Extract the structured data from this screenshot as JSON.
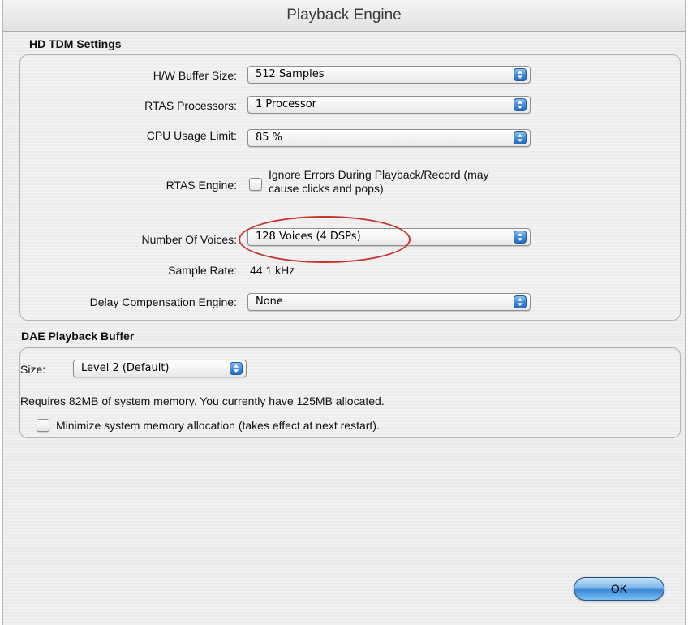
{
  "window": {
    "title": "Playback Engine"
  },
  "hd_tdm": {
    "group_label": "HD TDM Settings",
    "hw_buffer": {
      "label": "H/W Buffer Size:",
      "value": "512 Samples"
    },
    "rtas_processors": {
      "label": "RTAS Processors:",
      "value": "1 Processor"
    },
    "cpu_usage": {
      "label": "CPU Usage Limit:",
      "value": "85 %"
    },
    "rtas_engine": {
      "label": "RTAS Engine:",
      "checkbox_line1": "Ignore Errors During Playback/Record (may",
      "checkbox_line2": "cause clicks and pops)",
      "checked": false
    },
    "voices": {
      "label": "Number Of Voices:",
      "value": "128 Voices (4 DSPs)"
    },
    "sample_rate": {
      "label": "Sample Rate:",
      "value": "44.1 kHz"
    },
    "delay_comp": {
      "label": "Delay Compensation Engine:",
      "value": "None"
    }
  },
  "dae": {
    "group_label": "DAE Playback Buffer",
    "size": {
      "label": "Size:",
      "value": "Level 2 (Default)"
    },
    "memory_info": "Requires 82MB of system memory. You currently have 125MB allocated.",
    "minimize_label": "Minimize system memory allocation (takes effect at next restart).",
    "minimize_checked": false
  },
  "buttons": {
    "ok": "OK"
  },
  "colors": {
    "highlight_circle": "#c8322c",
    "popup_arrow_blue": "#3d86d6"
  }
}
